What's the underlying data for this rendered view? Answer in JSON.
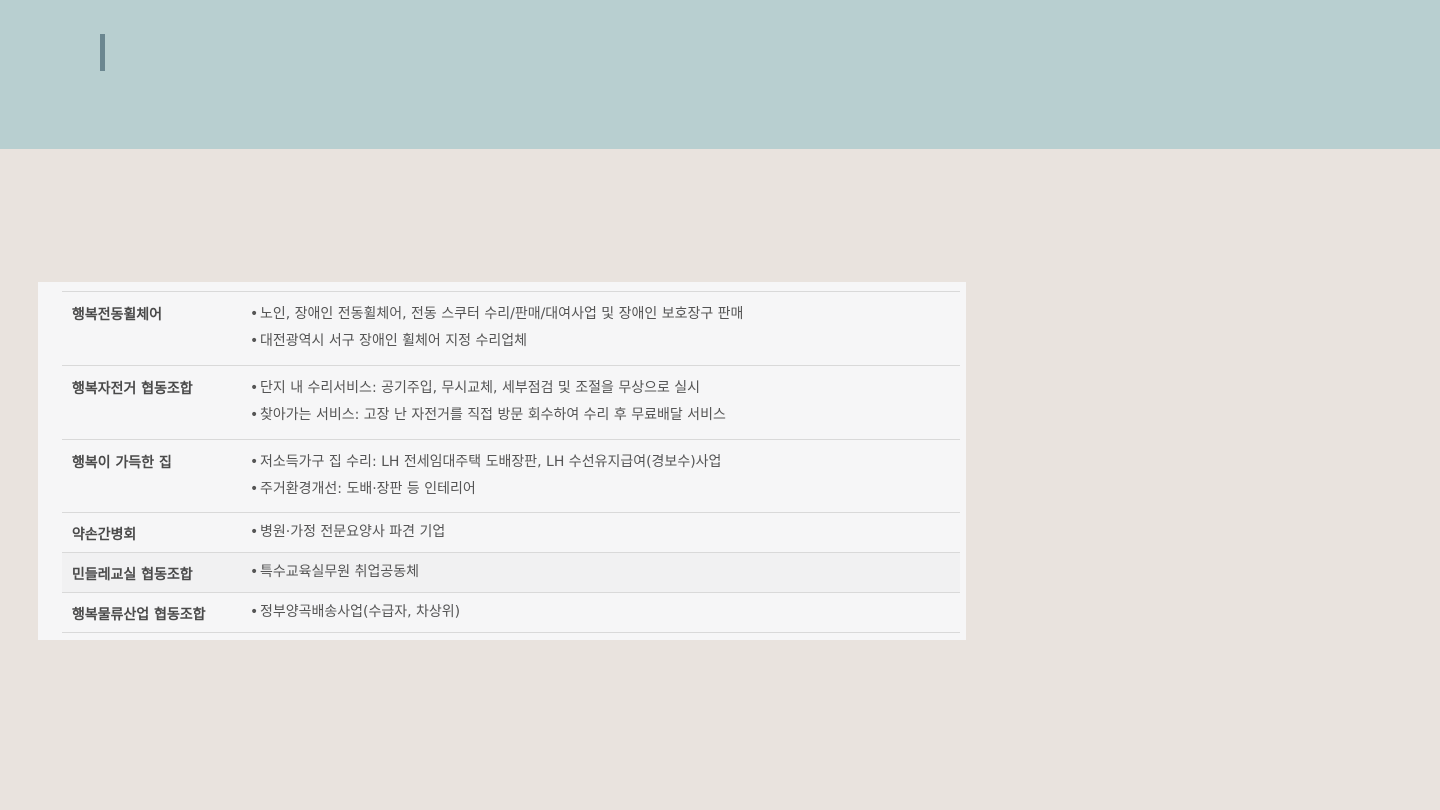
{
  "slide": {
    "title": ""
  },
  "orgs": [
    {
      "name": "행복전동휠체어",
      "items": [
        "노인, 장애인 전동휠체어, 전동 스쿠터 수리/판매/대여사업 및 장애인 보호장구 판매",
        "대전광역시 서구 장애인 휠체어 지정 수리업체"
      ]
    },
    {
      "name": "행복자전거 협동조합",
      "items": [
        "단지 내 수리서비스: 공기주입, 무시교체, 세부점검 및 조절을 무상으로 실시",
        "찾아가는 서비스: 고장 난 자전거를 직접 방문 회수하여 수리 후 무료배달 서비스"
      ]
    },
    {
      "name": "행복이 가득한 집",
      "items": [
        "저소득가구 집 수리: LH 전세임대주택 도배장판, LH 수선유지급여(경보수)사업",
        "주거환경개선: 도배·장판 등 인테리어"
      ]
    },
    {
      "name": "약손간병회",
      "items": [
        "병원·가정 전문요양사 파견 기업"
      ]
    },
    {
      "name": "민들레교실 협동조합",
      "items": [
        "특수교육실무원 취업공동체"
      ]
    },
    {
      "name": "행복물류산업 협동조합",
      "items": [
        "정부양곡배송사업(수급자, 차상위)"
      ]
    }
  ],
  "bullet": "•",
  "colors": {
    "header_band": "#b8cfd0",
    "title_accent": "#6b8790",
    "background": "#e9e3de",
    "panel": "#f6f6f7"
  }
}
